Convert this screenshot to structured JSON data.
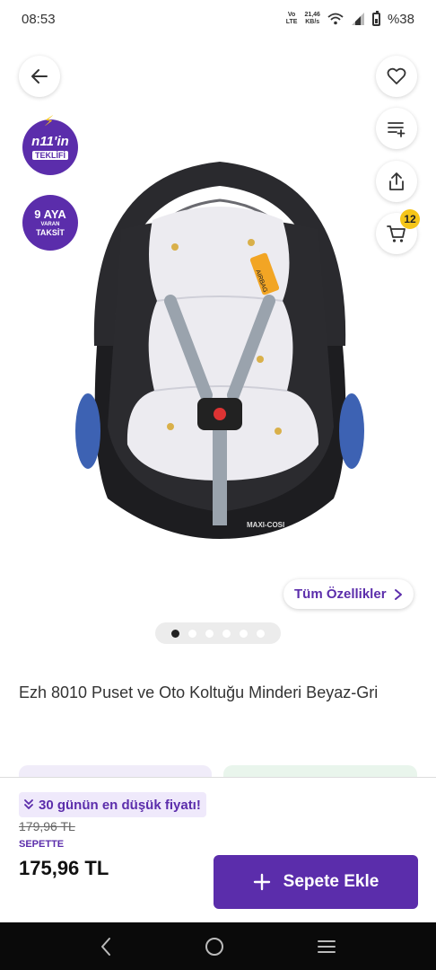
{
  "status_bar": {
    "time": "08:53",
    "network_top": "Vo",
    "network_bottom": "LTE",
    "speed_value": "21,46",
    "speed_unit": "KB/s",
    "battery": "%38"
  },
  "gallery": {
    "promo_badge_1": {
      "line1": "n11'in",
      "line2": "TEKLİFİ"
    },
    "promo_badge_2": {
      "line1": "9 AYA",
      "line2": "VARAN",
      "line3": "TAKSİT"
    },
    "cart_count": "12",
    "features_label": "Tüm Özellikler",
    "image_dots": {
      "count": 6,
      "active_index": 0
    },
    "product_brand_on_image": "MAXI-COSI",
    "airbag_label": "AIRBAG"
  },
  "product": {
    "title": "Ezh 8010 Puset ve Oto Koltuğu Minderi Beyaz-Gri"
  },
  "purchase": {
    "lowest_price_text": "30 günün en düşük fiyatı!",
    "old_price": "179,96 TL",
    "basket_label": "SEPETTE",
    "price": "175,96 TL",
    "add_to_cart_label": "Sepete Ekle"
  },
  "colors": {
    "brand_purple": "#5b2dab",
    "badge_yellow": "#f5c518"
  }
}
